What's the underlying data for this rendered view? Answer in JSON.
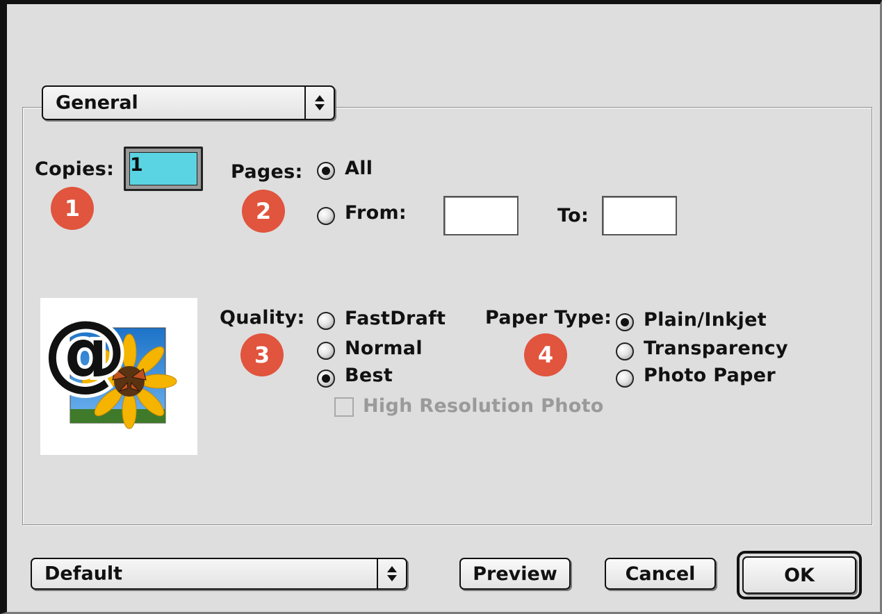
{
  "panel_popup": {
    "label": "General"
  },
  "copies": {
    "label": "Copies:",
    "value": "1",
    "badge": "1"
  },
  "pages": {
    "label": "Pages:",
    "badge": "2",
    "options": [
      {
        "label": "All",
        "selected": true
      },
      {
        "label": "From:",
        "selected": false
      }
    ],
    "from_value": "",
    "to_label": "To:",
    "to_value": ""
  },
  "preview_icon": {
    "glyph": "@"
  },
  "quality": {
    "label": "Quality:",
    "badge": "3",
    "options": [
      {
        "label": "FastDraft",
        "selected": false
      },
      {
        "label": "Normal",
        "selected": false
      },
      {
        "label": "Best",
        "selected": true
      }
    ],
    "high_res": {
      "label": "High Resolution Photo",
      "checked": false,
      "enabled": false
    }
  },
  "paper_type": {
    "label": "Paper Type:",
    "badge": "4",
    "options": [
      {
        "label": "Plain/Inkjet",
        "selected": true
      },
      {
        "label": "Transparency",
        "selected": false
      },
      {
        "label": "Photo Paper",
        "selected": false
      }
    ]
  },
  "footer": {
    "settings_popup": "Default",
    "preview_button": "Preview",
    "cancel_button": "Cancel",
    "ok_button": "OK"
  },
  "colors": {
    "badge": "#e1543d",
    "copies_field": "#5ad4e2",
    "dialog_bg": "#dedede"
  }
}
